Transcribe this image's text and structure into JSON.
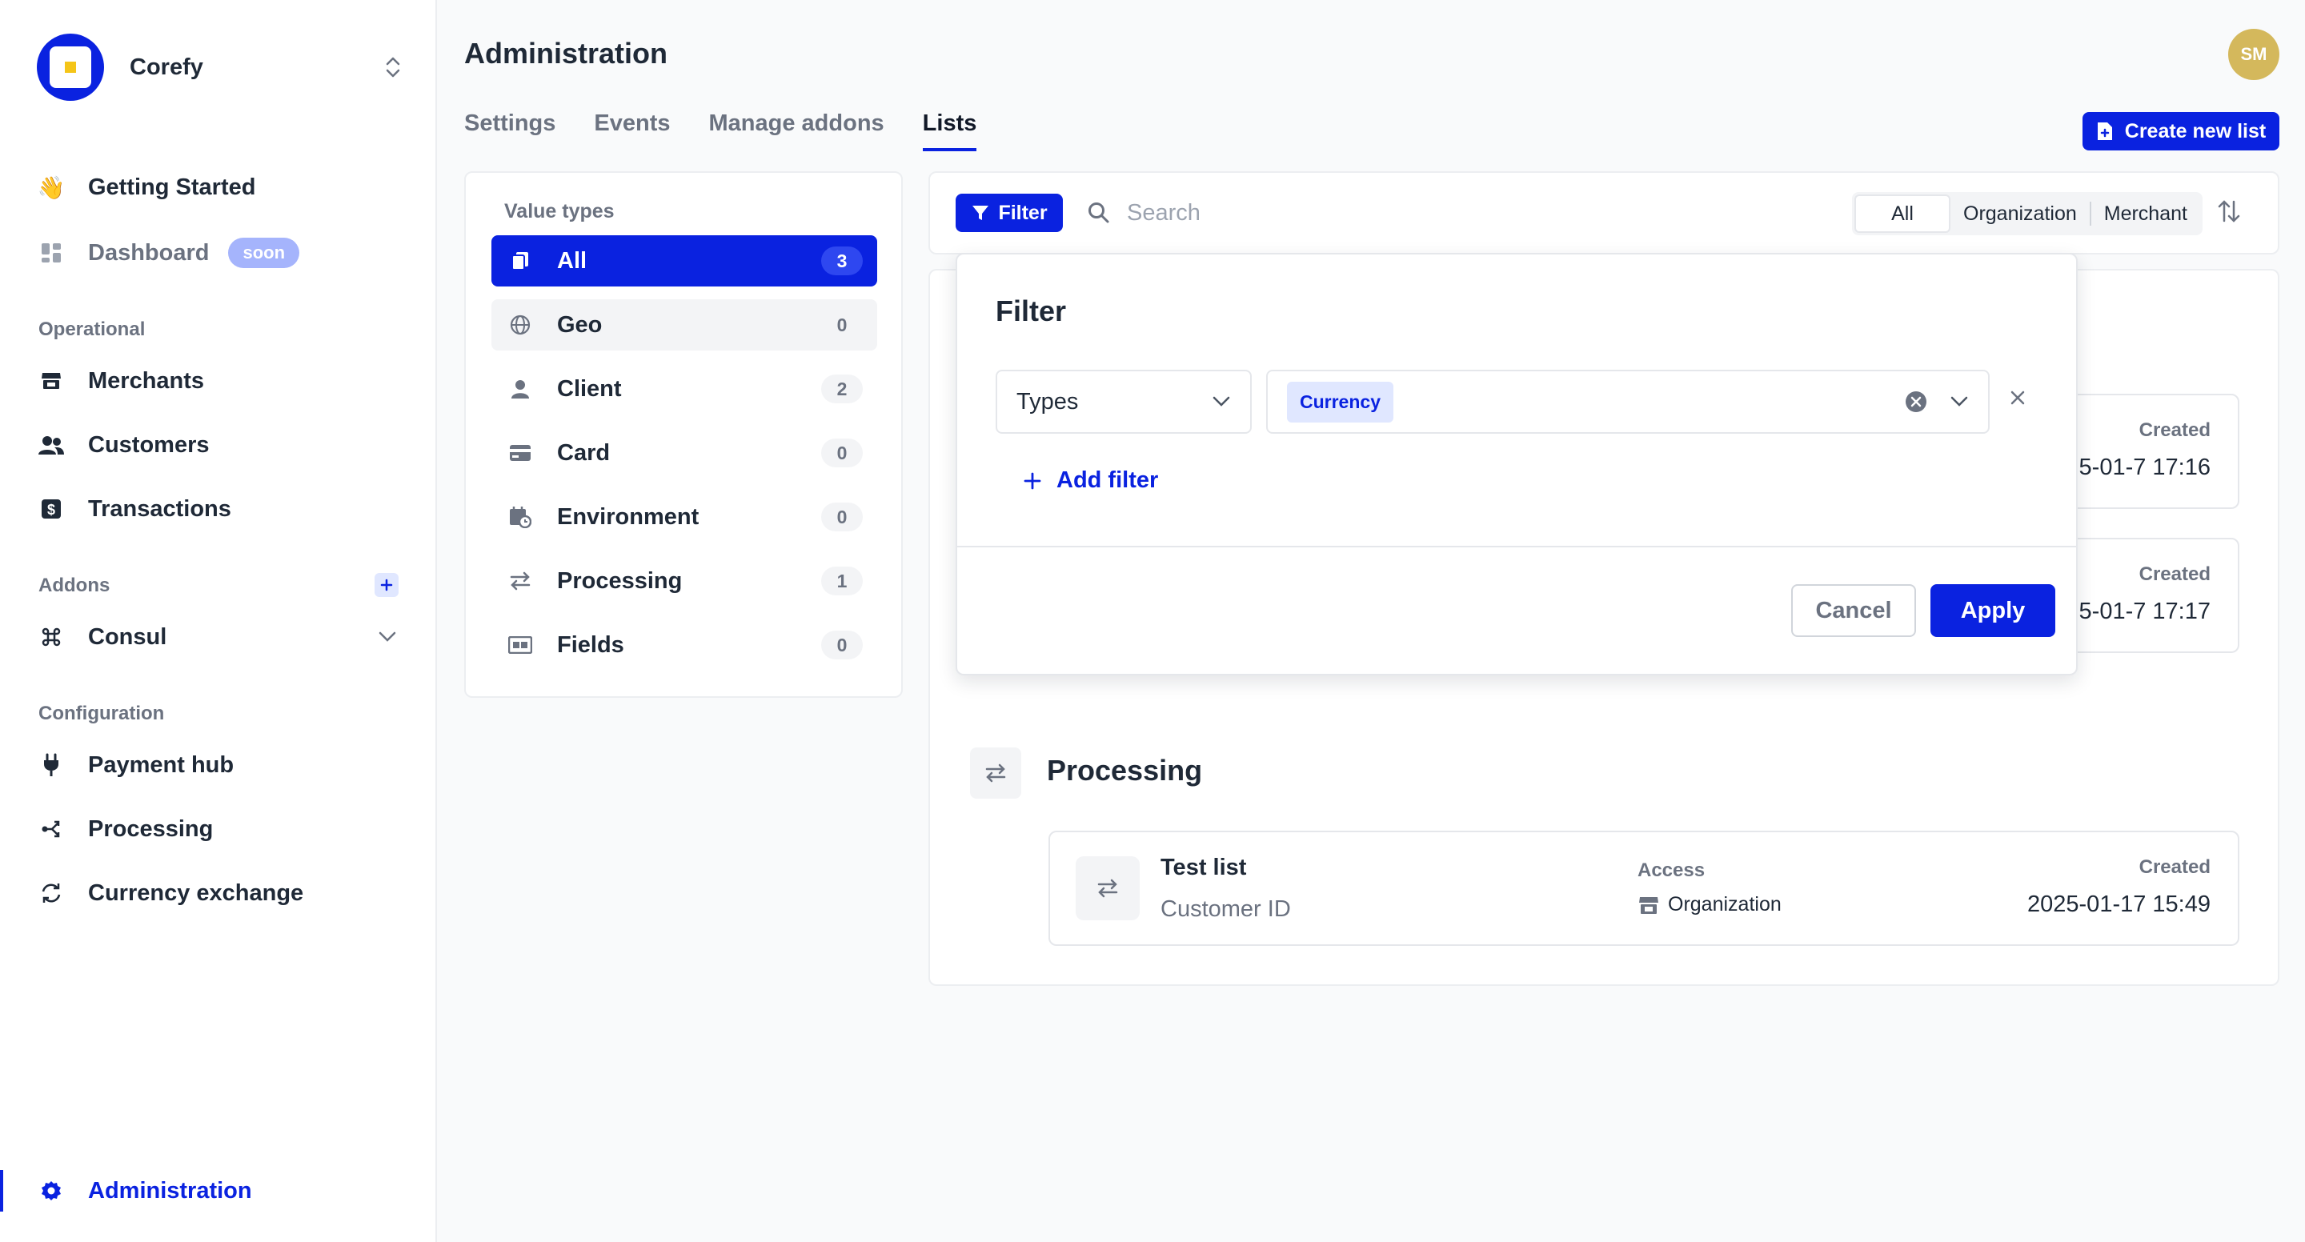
{
  "sidebar": {
    "org_name": "Corefy",
    "nav": {
      "getting_started": "Getting Started",
      "dashboard": "Dashboard",
      "soon_badge": "soon"
    },
    "sections": {
      "operational": "Operational",
      "addons": "Addons",
      "configuration": "Configuration"
    },
    "operational_items": [
      "Merchants",
      "Customers",
      "Transactions"
    ],
    "addon_items": [
      "Consul"
    ],
    "configuration_items": [
      "Payment hub",
      "Processing",
      "Currency exchange"
    ],
    "bottom_item": "Administration"
  },
  "header": {
    "title": "Administration",
    "avatar_initials": "SM",
    "tabs": [
      "Settings",
      "Events",
      "Manage addons",
      "Lists"
    ],
    "active_tab": "Lists",
    "create_button": "Create new list"
  },
  "value_types": {
    "title": "Value types",
    "items": [
      {
        "label": "All",
        "count": "3"
      },
      {
        "label": "Geo",
        "count": "0"
      },
      {
        "label": "Client",
        "count": "2"
      },
      {
        "label": "Card",
        "count": "0"
      },
      {
        "label": "Environment",
        "count": "0"
      },
      {
        "label": "Processing",
        "count": "1"
      },
      {
        "label": "Fields",
        "count": "0"
      }
    ]
  },
  "toolbar": {
    "filter_label": "Filter",
    "search_placeholder": "Search",
    "scope_options": [
      "All",
      "Organization",
      "Merchant"
    ],
    "active_scope": "All"
  },
  "lists": {
    "client_cards": [
      {
        "created_label": "Created",
        "created_value": "5-01-7 17:16"
      },
      {
        "created_label": "Created",
        "created_value": "5-01-7 17:17"
      }
    ],
    "processing_group": {
      "title": "Processing",
      "card": {
        "name": "Test list",
        "subtitle": "Customer ID",
        "access_label": "Access",
        "access_value": "Organization",
        "created_label": "Created",
        "created_value": "2025-01-17 15:49"
      }
    }
  },
  "filter_popover": {
    "title": "Filter",
    "field_select": "Types",
    "value_chip": "Currency",
    "add_filter": "Add filter",
    "cancel": "Cancel",
    "apply": "Apply"
  },
  "colors": {
    "accent": "#0a22e0",
    "avatar": "#d4b85c",
    "soon_badge": "#a5b4fc"
  }
}
